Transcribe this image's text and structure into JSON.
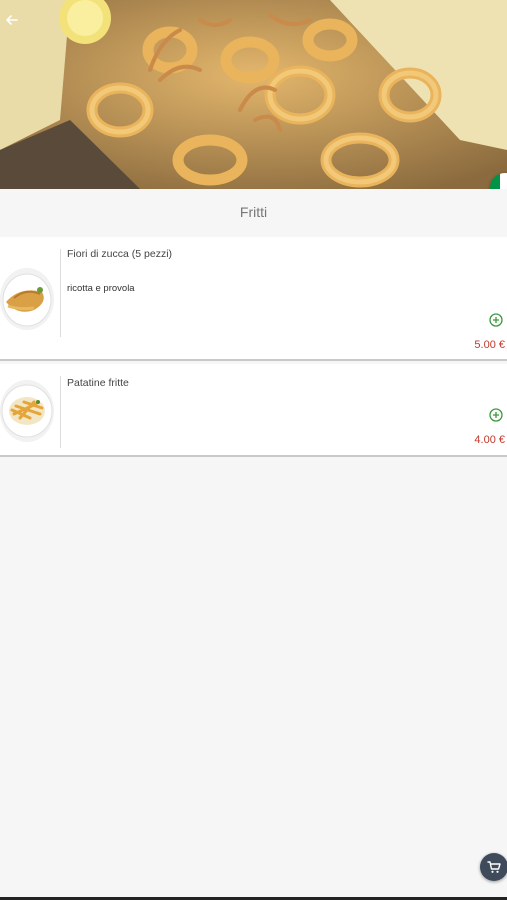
{
  "header": {
    "back_icon": "arrow-left-icon",
    "language_flag": "italian-flag-icon",
    "flag_colors": [
      "#009246",
      "#ffffff",
      "#ce2b37"
    ]
  },
  "category": {
    "title": "Fritti"
  },
  "products": [
    {
      "name": "Fiori di zucca (5 pezzi)",
      "description": "ricotta e provola",
      "price": "5.00 €",
      "add_icon": "plus-circle-icon"
    },
    {
      "name": "Patatine fritte",
      "description": "",
      "price": "4.00 €",
      "add_icon": "plus-circle-icon"
    }
  ],
  "cart": {
    "icon": "shopping-cart-icon"
  },
  "colors": {
    "price": "#c0392b",
    "add_icon": "#3a9a3a",
    "cart_fab": "#3f4b5a"
  }
}
